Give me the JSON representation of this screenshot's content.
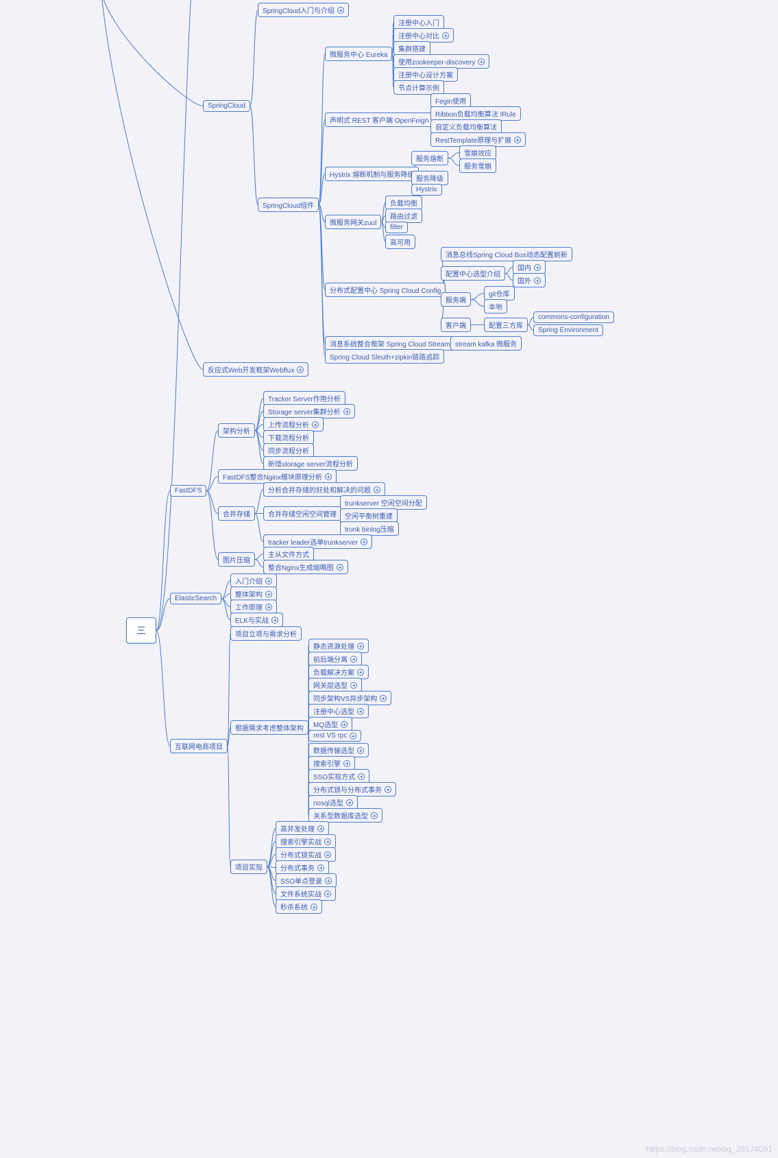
{
  "root": "三",
  "watermark": "https://blog.csdn.net/qq_38174081",
  "nodes": {
    "springcloud": "SpringCloud",
    "springcloud_intro": "SpringCloud入门与介绍",
    "eureka": "微服务中心 Eureka",
    "reg_intro": "注册中心入门",
    "reg_compare": "注册中心对比",
    "cluster": "集群搭建",
    "zookeeper": "使用zookeeper-discovery",
    "reg_design": "注册中心设计方案",
    "node_calc": "节点计算示例",
    "openfeign": "声明式 REST 客户端 OpenFeign",
    "feign_use": "Fegin使用",
    "ribbon_irule": "Ribbon负载均衡算法 IRule",
    "custom_lb": "自定义负载均衡算法",
    "resttemplate": "RestTemplate原理与扩展",
    "springcloud_comp": "SpringCloud组件",
    "hystrix_mech": "Hystrix 熔断机制与服务降级",
    "circuit_break": "服务熔断",
    "avalanche": "雪崩效应",
    "service_avalanche": "服务雪崩",
    "downgrade": "服务降级",
    "hystrix": "Hystrix",
    "zuul": "微服务网关zuul",
    "lb": "负载均衡",
    "route_filter": "路由过滤",
    "filter": "filter",
    "ha": "高可用",
    "config": "分布式配置中心 Spring Cloud Config",
    "bus": "消息总线Spring Cloud Bus动态配置刷新",
    "config_sel": "配置中心选型介绍",
    "domestic": "国内",
    "foreign": "国外",
    "server_side": "服务端",
    "git_repo": "git仓库",
    "local": "本地",
    "client_side": "客户端",
    "third_lib": "配置三方库",
    "commons_config": "commons-configuration",
    "spring_env": "Spring Environment",
    "stream": "消息系统整合框架 Spring Cloud Stream",
    "stream_detail": "stream kafka 微服务",
    "sleuth": "Spring Cloud Sleuth+zipkin链路追踪",
    "webflux": "反应式Web开发框架Webflux",
    "fastdfs": "FastDFS",
    "arch_analysis": "架构分析",
    "tracker": "Tracker Server作用分析",
    "storage_server": "Storage server集群分析",
    "upload": "上传流程分析",
    "download": "下载流程分析",
    "sync": "同步流程分析",
    "new_storage": "新增storage server流程分析",
    "nginx_module": "FastDFS整合Nginx模块原理分析",
    "merge_storage": "合并存储",
    "merge_analysis": "分析合并存储的好处和解决的问题",
    "space_mgmt": "合并存储空闲空间管理",
    "trunkserver": "trunkserver 空闲空间分配",
    "space_rebuild": "空闲平衡树重建",
    "trunk_binlog": "trunk binlog压缩",
    "tracker_leader": "tracker leader选单trunkserver",
    "img_compress": "图片压缩",
    "master_slave": "主从文件方式",
    "nginx_thumb": "整合Nginx生成缩略图",
    "elasticsearch": "ElasticSearch",
    "es_intro": "入门介绍",
    "es_arch": "整体架构",
    "es_principle": "工作原理",
    "elk": "ELK与实战",
    "ecom": "互联网电商项目",
    "req_analysis": "项目立项与需求分析",
    "overall_arch": "根据需求考虑整体架构",
    "static_res": "静态资源处理",
    "frontend_sep": "前后端分离",
    "lb_solution": "负载解决方案",
    "gateway_sel": "网关层选型",
    "sync_async": "同步架构VS异步架构",
    "reg_sel": "注册中心选型",
    "mq_sel": "MQ选型",
    "rest_rpc": "rest VS rpc",
    "data_trans": "数据传输选型",
    "search_engine": "搜索引擎",
    "sso_impl": "SSO实现方式",
    "dist_lock_tx": "分布式锁与分布式事务",
    "nosql_sel": "nosql选型",
    "rdb_sel": "关系型数据库选型",
    "proj_impl": "项目实现",
    "high_conc": "高并发处理",
    "search_practice": "搜索引擎实战",
    "lock_practice": "分布式锁实战",
    "tx_practice": "分布式事务",
    "sso_login": "SSO单点登录",
    "fs_practice": "文件系统实战",
    "seckill": "秒杀系统"
  }
}
